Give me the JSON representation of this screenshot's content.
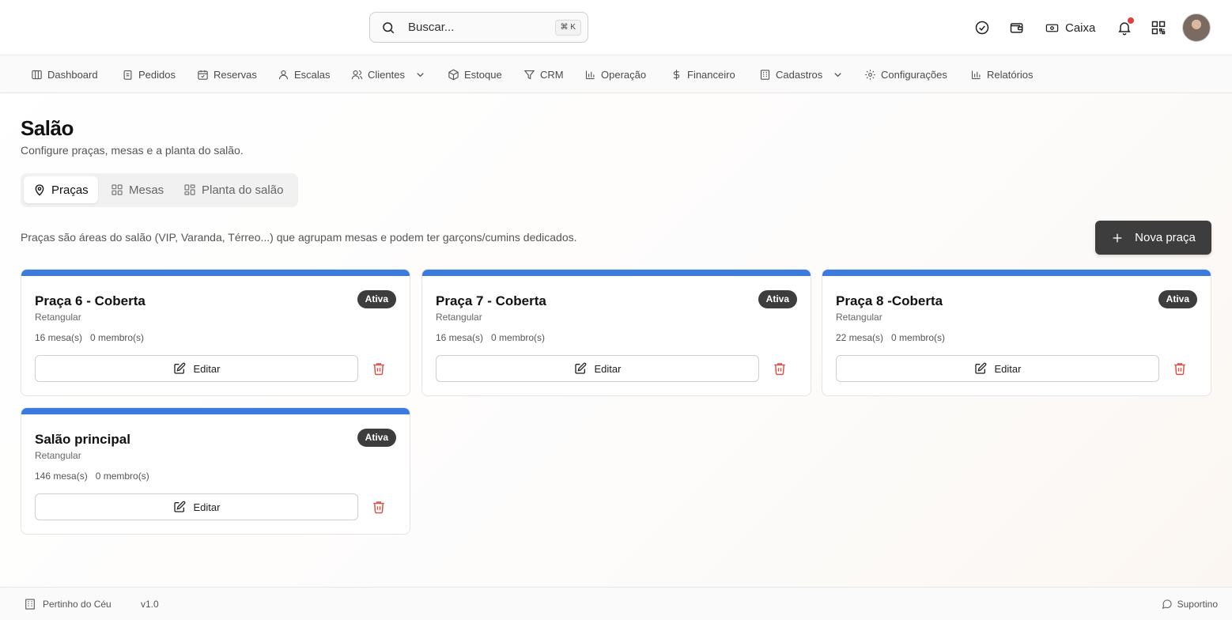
{
  "search": {
    "placeholder": "Buscar...",
    "shortcut": "⌘ K"
  },
  "topbar": {
    "caixa_label": "Caixa",
    "icons": [
      "check-circle-icon",
      "wallet-icon",
      "cash-icon",
      "bell-icon",
      "qr-code-icon"
    ],
    "notification_dot_color": "#e04040"
  },
  "nav": {
    "items": [
      {
        "label": "Dashboard",
        "icon": "dashboard-icon"
      },
      {
        "label": "Pedidos",
        "icon": "clipboard-icon"
      },
      {
        "label": "Reservas",
        "icon": "calendar-check-icon"
      },
      {
        "label": "Escalas",
        "icon": "user-icon"
      },
      {
        "label": "Clientes",
        "icon": "users-icon",
        "has_dropdown": true
      },
      {
        "label": "Estoque",
        "icon": "package-icon"
      },
      {
        "label": "CRM",
        "icon": "funnel-icon"
      },
      {
        "label": "Operação",
        "icon": "bar-chart-icon"
      },
      {
        "label": "Financeiro",
        "icon": "dollar-icon"
      },
      {
        "label": "Cadastros",
        "icon": "building-icon",
        "has_dropdown": true
      },
      {
        "label": "Configurações",
        "icon": "gear-icon"
      },
      {
        "label": "Relatórios",
        "icon": "bar-chart-icon"
      }
    ]
  },
  "page": {
    "title": "Salão",
    "subtitle": "Configure praças, mesas e a planta do salão.",
    "tabs": [
      {
        "label": "Praças",
        "icon": "map-pin-icon",
        "active": true
      },
      {
        "label": "Mesas",
        "icon": "grid-icon",
        "active": false
      },
      {
        "label": "Planta do salão",
        "icon": "grid-icon",
        "active": false
      }
    ],
    "info": "Praças são áreas do salão (VIP, Varanda, Térreo...) que agrupam mesas e podem ter garçons/cumins dedicados.",
    "new_button": "Nova praça"
  },
  "cards": [
    {
      "title": "Praça 6 - Coberta",
      "shape": "Retangular",
      "tables": "16 mesa(s)",
      "members": "0 membro(s)",
      "status": "Ativa",
      "edit": "Editar"
    },
    {
      "title": "Praça 7 - Coberta",
      "shape": "Retangular",
      "tables": "16 mesa(s)",
      "members": "0 membro(s)",
      "status": "Ativa",
      "edit": "Editar"
    },
    {
      "title": "Praça 8 -Coberta",
      "shape": "Retangular",
      "tables": "22 mesa(s)",
      "members": "0 membro(s)",
      "status": "Ativa",
      "edit": "Editar"
    },
    {
      "title": "Salão principal",
      "shape": "Retangular",
      "tables": "146 mesa(s)",
      "members": "0 membro(s)",
      "status": "Ativa",
      "edit": "Editar"
    }
  ],
  "colors": {
    "accent_bar": "#3b7be0",
    "badge_bg": "#3d3d3d",
    "delete": "#d9534f"
  },
  "footer": {
    "restaurant": "Pertinho do Céu",
    "version": "v1.0",
    "support": "Suportino"
  }
}
